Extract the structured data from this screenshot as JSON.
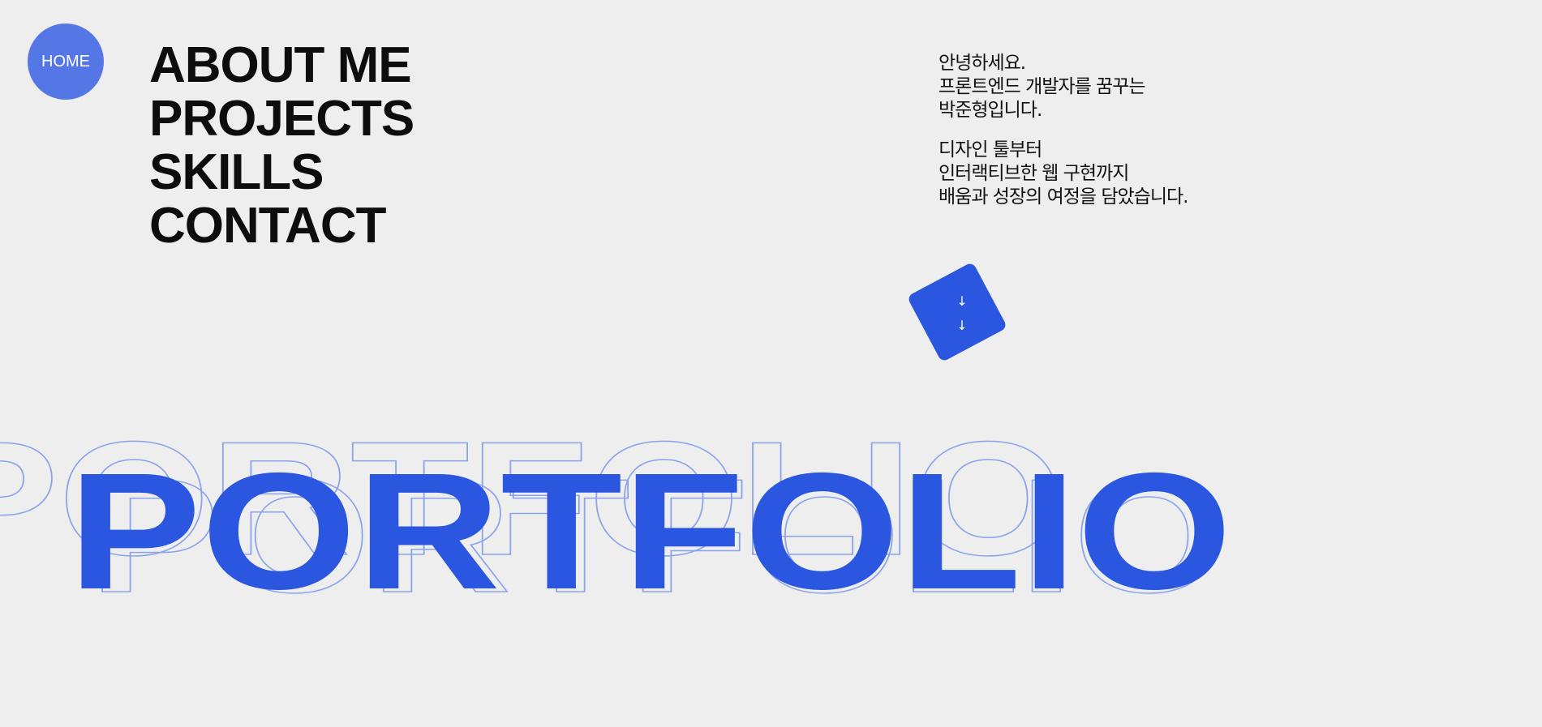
{
  "nav": {
    "home_label": "HOME",
    "items": [
      {
        "label": "ABOUT ME"
      },
      {
        "label": "PROJECTS"
      },
      {
        "label": "SKILLS"
      },
      {
        "label": "CONTACT"
      }
    ]
  },
  "intro": {
    "paragraph_1": [
      "안녕하세요.",
      "프론트엔드 개발자를 꿈꾸는",
      "박준형입니다."
    ],
    "paragraph_2": [
      "디자인 툴부터",
      "인터랙티브한 웹 구현까지",
      "배움과 성장의 여정을 담았습니다."
    ]
  },
  "scroll_button": {
    "icon": "arrow-down-icon"
  },
  "hero": {
    "title": "PORTFOLIO"
  },
  "colors": {
    "accent": "#2b57e0",
    "home_button": "#5577e6",
    "outline": "#8aa3ec",
    "background": "#eeeeee",
    "text": "#0d0d0d"
  }
}
